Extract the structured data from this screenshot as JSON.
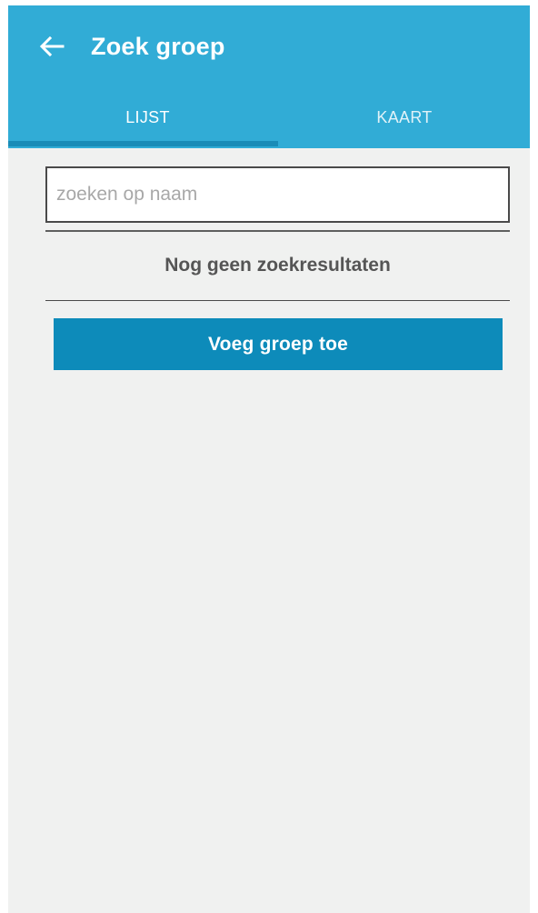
{
  "header": {
    "title": "Zoek groep",
    "back_icon": "arrow-left-icon"
  },
  "tabs": [
    {
      "label": "LIJST",
      "selected": true
    },
    {
      "label": "KAART",
      "selected": false
    }
  ],
  "search": {
    "placeholder": "zoeken op naam",
    "value": ""
  },
  "results": {
    "empty_message": "Nog geen zoekresultaten"
  },
  "actions": {
    "add_group_label": "Voeg groep toe"
  },
  "colors": {
    "appbar": "#31acd6",
    "tab_indicator": "#1a8cb7",
    "primary_button": "#0d8bba",
    "background": "#f0f1f0"
  }
}
